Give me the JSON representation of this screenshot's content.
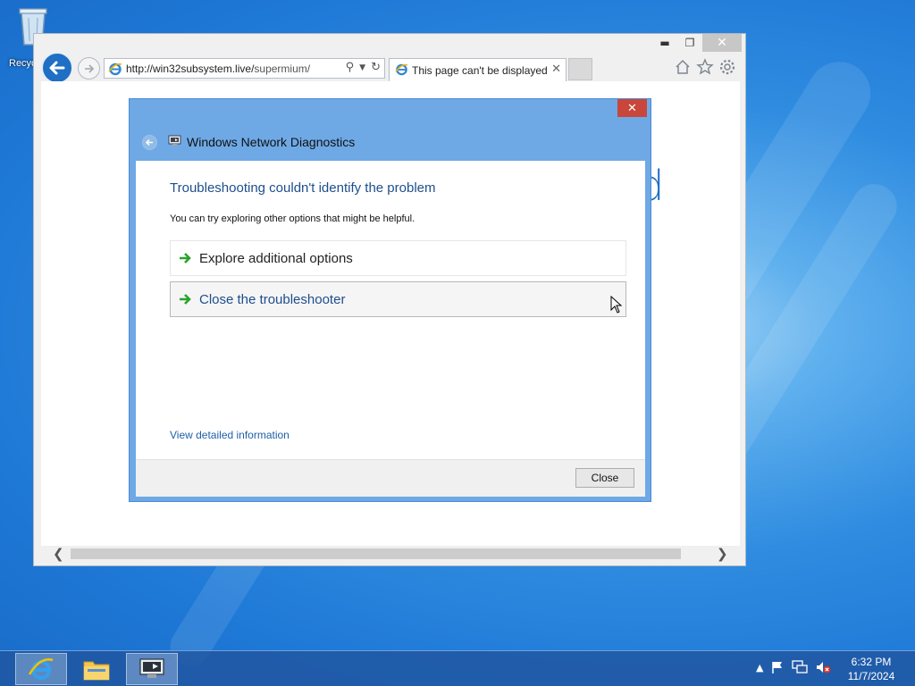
{
  "desktop": {
    "recycle_bin_label": "Recyc"
  },
  "browser": {
    "window_controls": {
      "minimize": "▬",
      "maximize": "❐",
      "close": "✕"
    },
    "address": {
      "url_host": "http://win32subsystem.live/",
      "url_path": "supermium/"
    },
    "tab": {
      "title": "This page can't be displayed",
      "close": "✕"
    },
    "page_heading_fragment": "ed",
    "icons": [
      "back-arrow-icon",
      "forward-arrow-icon",
      "search-icon",
      "dropdown-icon",
      "refresh-icon",
      "home-icon",
      "favorites-star-icon",
      "settings-gear-icon"
    ]
  },
  "dialog": {
    "title": "Windows Network Diagnostics",
    "close_label": "✕",
    "heading": "Troubleshooting couldn't identify the problem",
    "subtext": "You can try exploring other options that might be helpful.",
    "options": [
      {
        "label": "Explore additional options"
      },
      {
        "label": "Close the troubleshooter"
      }
    ],
    "detail_link": "View detailed information",
    "close_button": "Close",
    "accent_color": "#6ea9e6",
    "heading_color": "#1e4e8c",
    "arrow_color": "#2aa32a"
  },
  "taskbar": {
    "time": "6:32 PM",
    "date": "11/7/2024",
    "tray": {
      "chevron": "▲"
    }
  }
}
